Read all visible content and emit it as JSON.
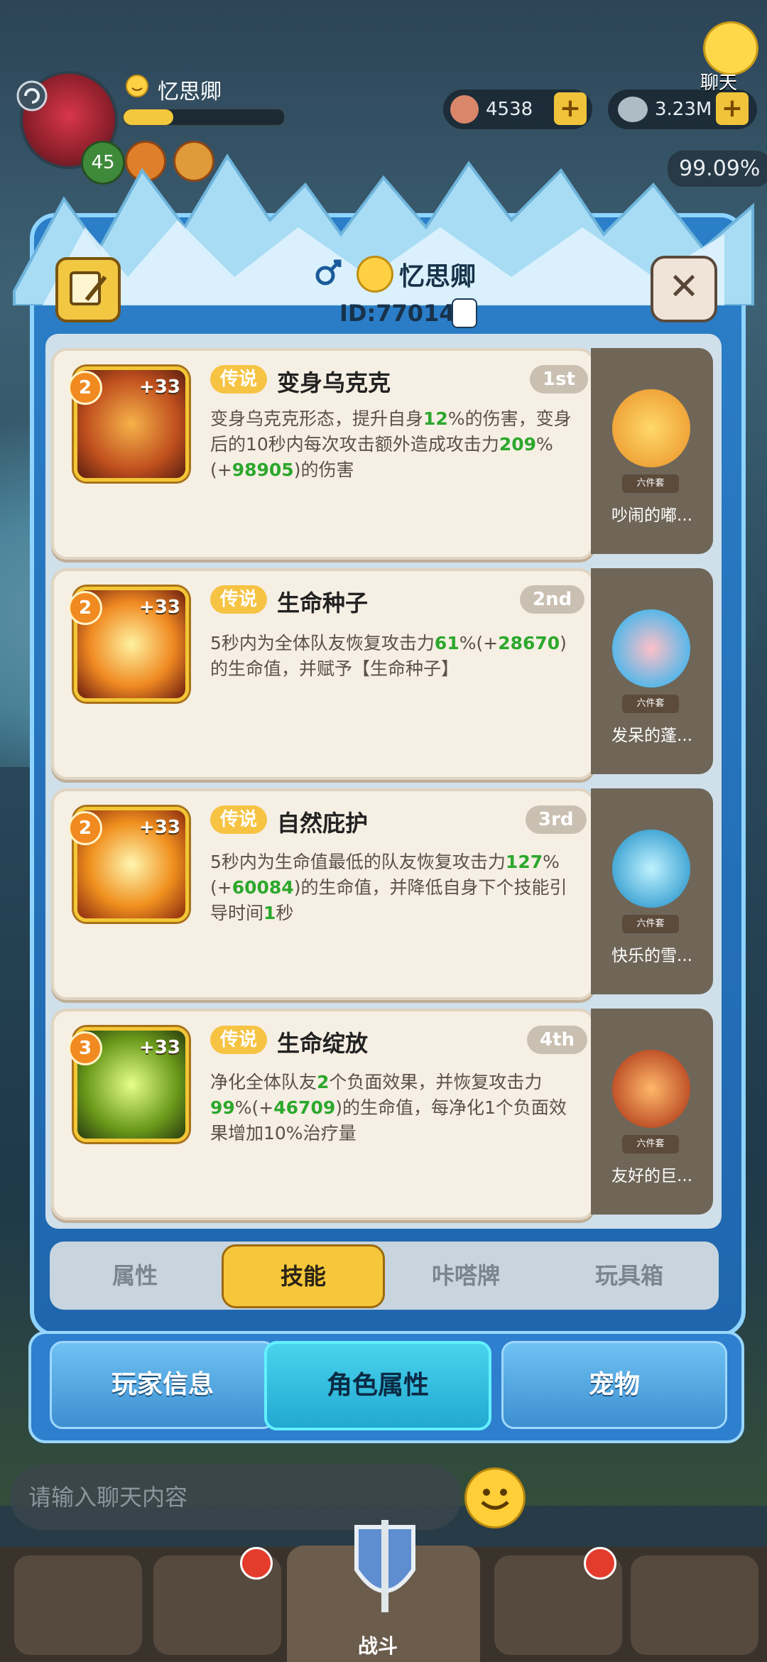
{
  "hud": {
    "player_name": "忆思卿",
    "level": "45",
    "shells": "4538",
    "pearls": "3.23M",
    "percent": "99.09%",
    "chat_label": "聊天"
  },
  "header": {
    "name": "忆思卿",
    "id": "ID:770149"
  },
  "skills": [
    {
      "level": "2",
      "bonus": "+33",
      "rarity": "传说",
      "name": "变身乌克克",
      "rank": "1st",
      "desc_1": "变身乌克克形态，提升自身",
      "num_1": "12",
      "desc_2": "%的伤害，变身后的10秒内每次攻击额外造成攻击力",
      "num_2": "209",
      "desc_3": "%(+",
      "num_3": "98905",
      "desc_4": ")的伤害",
      "pet_name": "吵闹的嘟...",
      "pet_set": "六件套"
    },
    {
      "level": "2",
      "bonus": "+33",
      "rarity": "传说",
      "name": "生命种子",
      "rank": "2nd",
      "desc_1": "5秒内为全体队友恢复攻击力",
      "num_1": "61",
      "desc_2": "%(+",
      "num_2": "28670",
      "desc_3": ")的生命值，并赋予【生命种子】",
      "pet_name": "发呆的蓬...",
      "pet_set": "六件套"
    },
    {
      "level": "2",
      "bonus": "+33",
      "rarity": "传说",
      "name": "自然庇护",
      "rank": "3rd",
      "desc_1": "5秒内为生命值最低的队友恢复攻击力",
      "num_1": "127",
      "desc_2": "%(+",
      "num_2": "60084",
      "desc_3": ")的生命值，并降低自身下个技能引导时间",
      "num_3": "1",
      "desc_4": "秒",
      "pet_name": "快乐的雪...",
      "pet_set": "六件套"
    },
    {
      "level": "3",
      "bonus": "+33",
      "rarity": "传说",
      "name": "生命绽放",
      "rank": "4th",
      "desc_1": "净化全体队友",
      "num_1": "2",
      "desc_2": "个负面效果，并恢复攻击力",
      "num_2": "99",
      "desc_3": "%(+",
      "num_3": "46709",
      "desc_4": ")的生命值，每净化1个负面效果增加10%治疗量",
      "pet_name": "友好的巨...",
      "pet_set": "六件套"
    }
  ],
  "inner_tabs": [
    "属性",
    "技能",
    "咔嗒牌",
    "玩具箱"
  ],
  "bottom_tabs": [
    "玩家信息",
    "角色属性",
    "宠物"
  ],
  "chat": {
    "placeholder": "请输入聊天内容"
  },
  "nav": {
    "center_label": "战斗"
  },
  "colors": {
    "accent": "#f6c73b",
    "number_green": "#2ca82c",
    "modal_blue": "#2b7fc8"
  }
}
